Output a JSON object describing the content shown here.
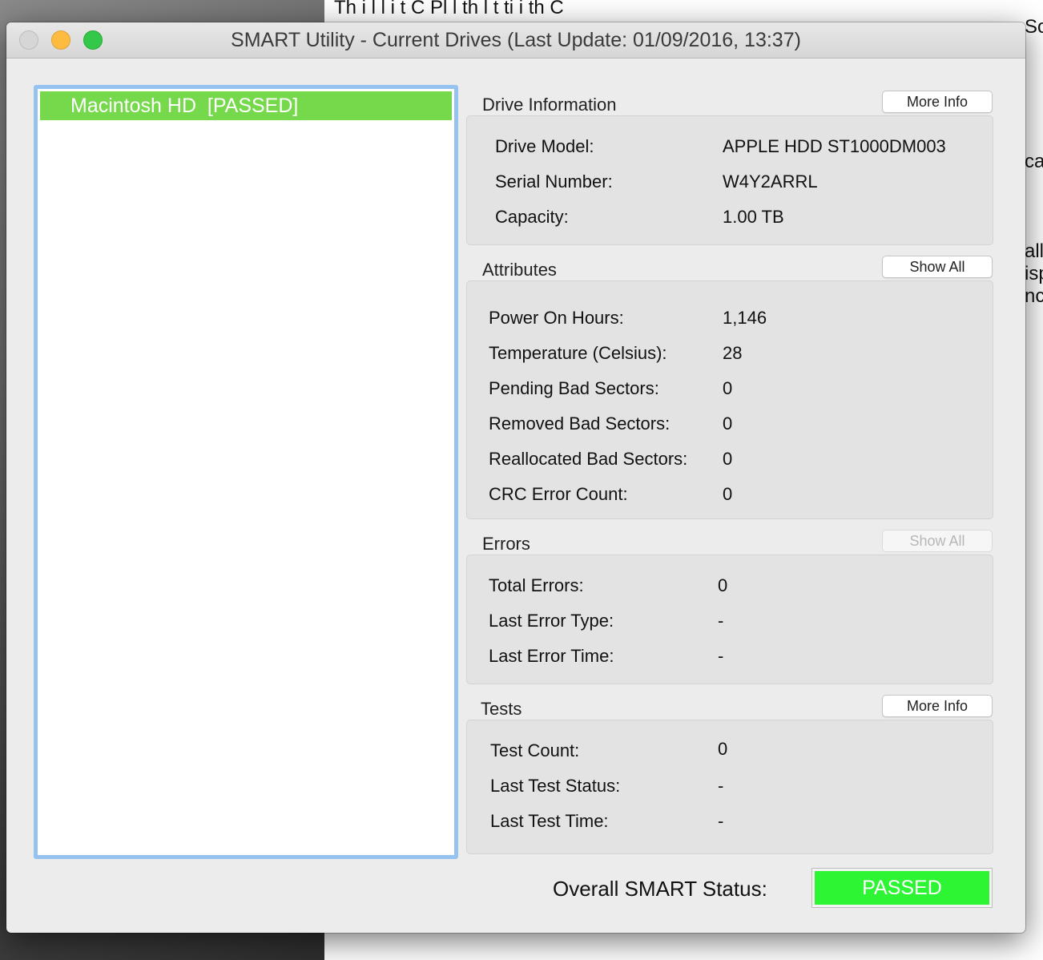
{
  "window": {
    "title": "SMART Utility - Current Drives (Last Update: 01/09/2016, 13:37)"
  },
  "background_doc": {
    "line1": "Th    i    l   l  i  t  C      Pl         l th  l         t ti  i  th  C",
    "frag_so": "So",
    "frag_ca": "ca",
    "frag_all": "all",
    "frag_isp": "isp",
    "frag_nc": "nc"
  },
  "drives": [
    {
      "name": "Macintosh HD",
      "status": "[PASSED]",
      "label": "Macintosh HD  [PASSED]"
    }
  ],
  "drive_information": {
    "label": "Drive Information",
    "button": "More Info",
    "rows": [
      {
        "label": "Drive Model:",
        "value": "APPLE HDD ST1000DM003"
      },
      {
        "label": "Serial Number:",
        "value": "W4Y2ARRL"
      },
      {
        "label": "Capacity:",
        "value": "1.00 TB"
      }
    ]
  },
  "attributes": {
    "label": "Attributes",
    "button": "Show All",
    "rows": [
      {
        "label": "Power On Hours:",
        "value": "1,146"
      },
      {
        "label": "Temperature (Celsius):",
        "value": "28"
      },
      {
        "label": "Pending Bad Sectors:",
        "value": "0"
      },
      {
        "label": "Removed Bad Sectors:",
        "value": "0"
      },
      {
        "label": "Reallocated Bad Sectors:",
        "value": "0"
      },
      {
        "label": "CRC Error Count:",
        "value": "0"
      }
    ]
  },
  "errors": {
    "label": "Errors",
    "button": "Show All",
    "button_disabled": true,
    "rows": [
      {
        "label": "Total Errors:",
        "value": "0"
      },
      {
        "label": "Last Error Type:",
        "value": "-"
      },
      {
        "label": "Last Error Time:",
        "value": "-"
      }
    ]
  },
  "tests": {
    "label": "Tests",
    "button": "More Info",
    "rows": [
      {
        "label": "Test Count:",
        "value": "0"
      },
      {
        "label": "Last Test Status:",
        "value": "-"
      },
      {
        "label": "Last Test Time:",
        "value": "-"
      }
    ]
  },
  "overall": {
    "label": "Overall SMART Status:",
    "status": "PASSED"
  },
  "colors": {
    "passed_row": "#75d94b",
    "passed_badge": "#2ef534",
    "list_focus_ring": "#95c2ee",
    "traffic_min": "#fdbc40",
    "traffic_max": "#34c84a"
  }
}
